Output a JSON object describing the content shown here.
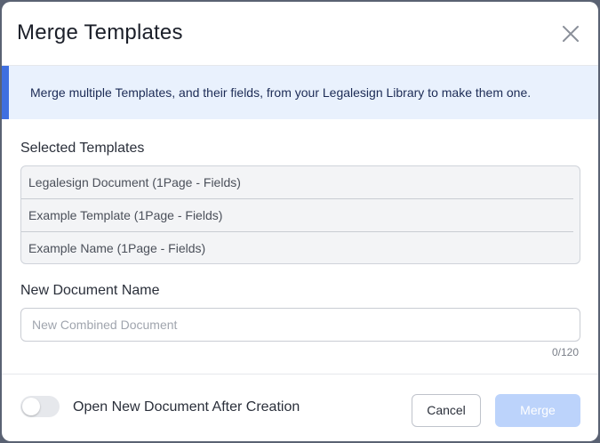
{
  "dialog": {
    "title": "Merge Templates",
    "info": "Merge multiple Templates, and their fields, from your Legalesign Library to make them one."
  },
  "selected_templates": {
    "label": "Selected Templates",
    "items": [
      "Legalesign Document (1Page - Fields)",
      "Example Template (1Page - Fields)",
      "Example Name (1Page - Fields)"
    ]
  },
  "new_document": {
    "label": "New Document Name",
    "placeholder": "New Combined Document",
    "value": "",
    "char_count": "0/120"
  },
  "footer": {
    "toggle_label": "Open New Document After Creation",
    "toggle_on": false,
    "cancel_label": "Cancel",
    "merge_label": "Merge"
  },
  "colors": {
    "accent": "#3f6fe0",
    "banner_bg": "#e9f1fd",
    "merge_disabled": "#bcd3fb"
  },
  "icons": {
    "close": "close-icon"
  }
}
